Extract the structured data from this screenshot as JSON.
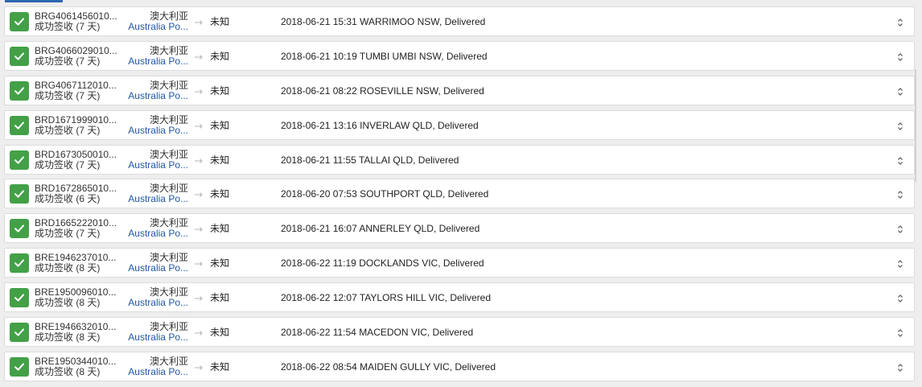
{
  "rows": [
    {
      "tracking": "BRG4061456010...",
      "status": "成功签收 (7 天)",
      "country": "澳大利亚",
      "carrier": "Australia Po...",
      "destination": "未知",
      "event": "2018-06-21 15:31 WARRIMOO NSW, Delivered"
    },
    {
      "tracking": "BRG4066029010...",
      "status": "成功签收 (7 天)",
      "country": "澳大利亚",
      "carrier": "Australia Po...",
      "destination": "未知",
      "event": "2018-06-21 10:19 TUMBI UMBI NSW, Delivered"
    },
    {
      "tracking": "BRG4067112010...",
      "status": "成功签收 (7 天)",
      "country": "澳大利亚",
      "carrier": "Australia Po...",
      "destination": "未知",
      "event": "2018-06-21 08:22 ROSEVILLE NSW, Delivered"
    },
    {
      "tracking": "BRD1671999010...",
      "status": "成功签收 (7 天)",
      "country": "澳大利亚",
      "carrier": "Australia Po...",
      "destination": "未知",
      "event": "2018-06-21 13:16 INVERLAW QLD, Delivered"
    },
    {
      "tracking": "BRD1673050010...",
      "status": "成功签收 (7 天)",
      "country": "澳大利亚",
      "carrier": "Australia Po...",
      "destination": "未知",
      "event": "2018-06-21 11:55 TALLAI QLD, Delivered"
    },
    {
      "tracking": "BRD1672865010...",
      "status": "成功签收 (6 天)",
      "country": "澳大利亚",
      "carrier": "Australia Po...",
      "destination": "未知",
      "event": "2018-06-20 07:53 SOUTHPORT QLD, Delivered"
    },
    {
      "tracking": "BRD1665222010...",
      "status": "成功签收 (7 天)",
      "country": "澳大利亚",
      "carrier": "Australia Po...",
      "destination": "未知",
      "event": "2018-06-21 16:07 ANNERLEY QLD, Delivered"
    },
    {
      "tracking": "BRE1946237010...",
      "status": "成功签收 (8 天)",
      "country": "澳大利亚",
      "carrier": "Australia Po...",
      "destination": "未知",
      "event": "2018-06-22 11:19 DOCKLANDS VIC, Delivered"
    },
    {
      "tracking": "BRE1950096010...",
      "status": "成功签收 (8 天)",
      "country": "澳大利亚",
      "carrier": "Australia Po...",
      "destination": "未知",
      "event": "2018-06-22 12:07 TAYLORS HILL VIC, Delivered"
    },
    {
      "tracking": "BRE1946632010...",
      "status": "成功签收 (8 天)",
      "country": "澳大利亚",
      "carrier": "Australia Po...",
      "destination": "未知",
      "event": "2018-06-22 11:54 MACEDON VIC, Delivered"
    },
    {
      "tracking": "BRE1950344010...",
      "status": "成功签收 (8 天)",
      "country": "澳大利亚",
      "carrier": "Australia Po...",
      "destination": "未知",
      "event": "2018-06-22 08:54 MAIDEN GULLY VIC, Delivered"
    }
  ],
  "colors": {
    "status_success": "#43a047",
    "carrier_link": "#1f57a7",
    "active_tab": "#2b66b1"
  },
  "icons": {
    "status": "check-icon",
    "route": "arrow-right-icon",
    "expand": "expand-toggle-icon"
  }
}
